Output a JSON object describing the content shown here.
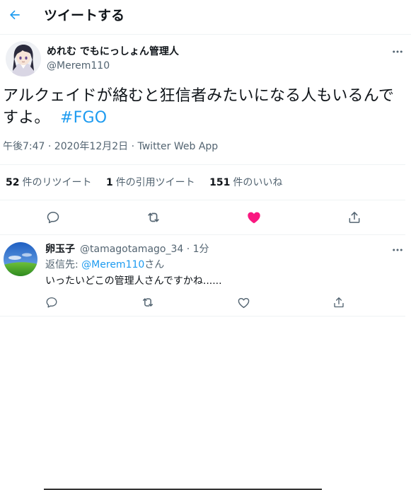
{
  "header": {
    "title": "ツイートする"
  },
  "tweet": {
    "author_name": "めれむ でもにっしょん管理人",
    "author_handle": "@Merem110",
    "text": "アルクェイドが絡むと狂信者みたいになる人もいるんですよ。",
    "hashtag": "#FGO",
    "meta": "午後7:47 · 2020年12月2日 · Twitter Web App",
    "stats": {
      "retweets_count": "52",
      "retweets_label": "件のリツイート",
      "quotes_count": "1",
      "quotes_label": "件の引用ツイート",
      "likes_count": "151",
      "likes_label": "件のいいね"
    },
    "liked": true
  },
  "reply": {
    "author_name": "卵玉子",
    "handle_time": "@tamagotamago_34 · 1分",
    "reply_to_prefix": "返信先: ",
    "reply_to_mention": "@Merem110",
    "reply_to_suffix": "さん",
    "text": "いったいどこの管理人さんですかね......"
  },
  "colors": {
    "accent": "#1d9bf0",
    "like": "#f91880",
    "secondary_text": "#536471",
    "divider": "#eff3f4"
  },
  "icons": {
    "back": "arrow-left-icon",
    "more": "more-horizontal-icon",
    "reply": "reply-bubble-icon",
    "retweet": "retweet-icon",
    "like": "heart-icon",
    "share": "share-icon"
  }
}
